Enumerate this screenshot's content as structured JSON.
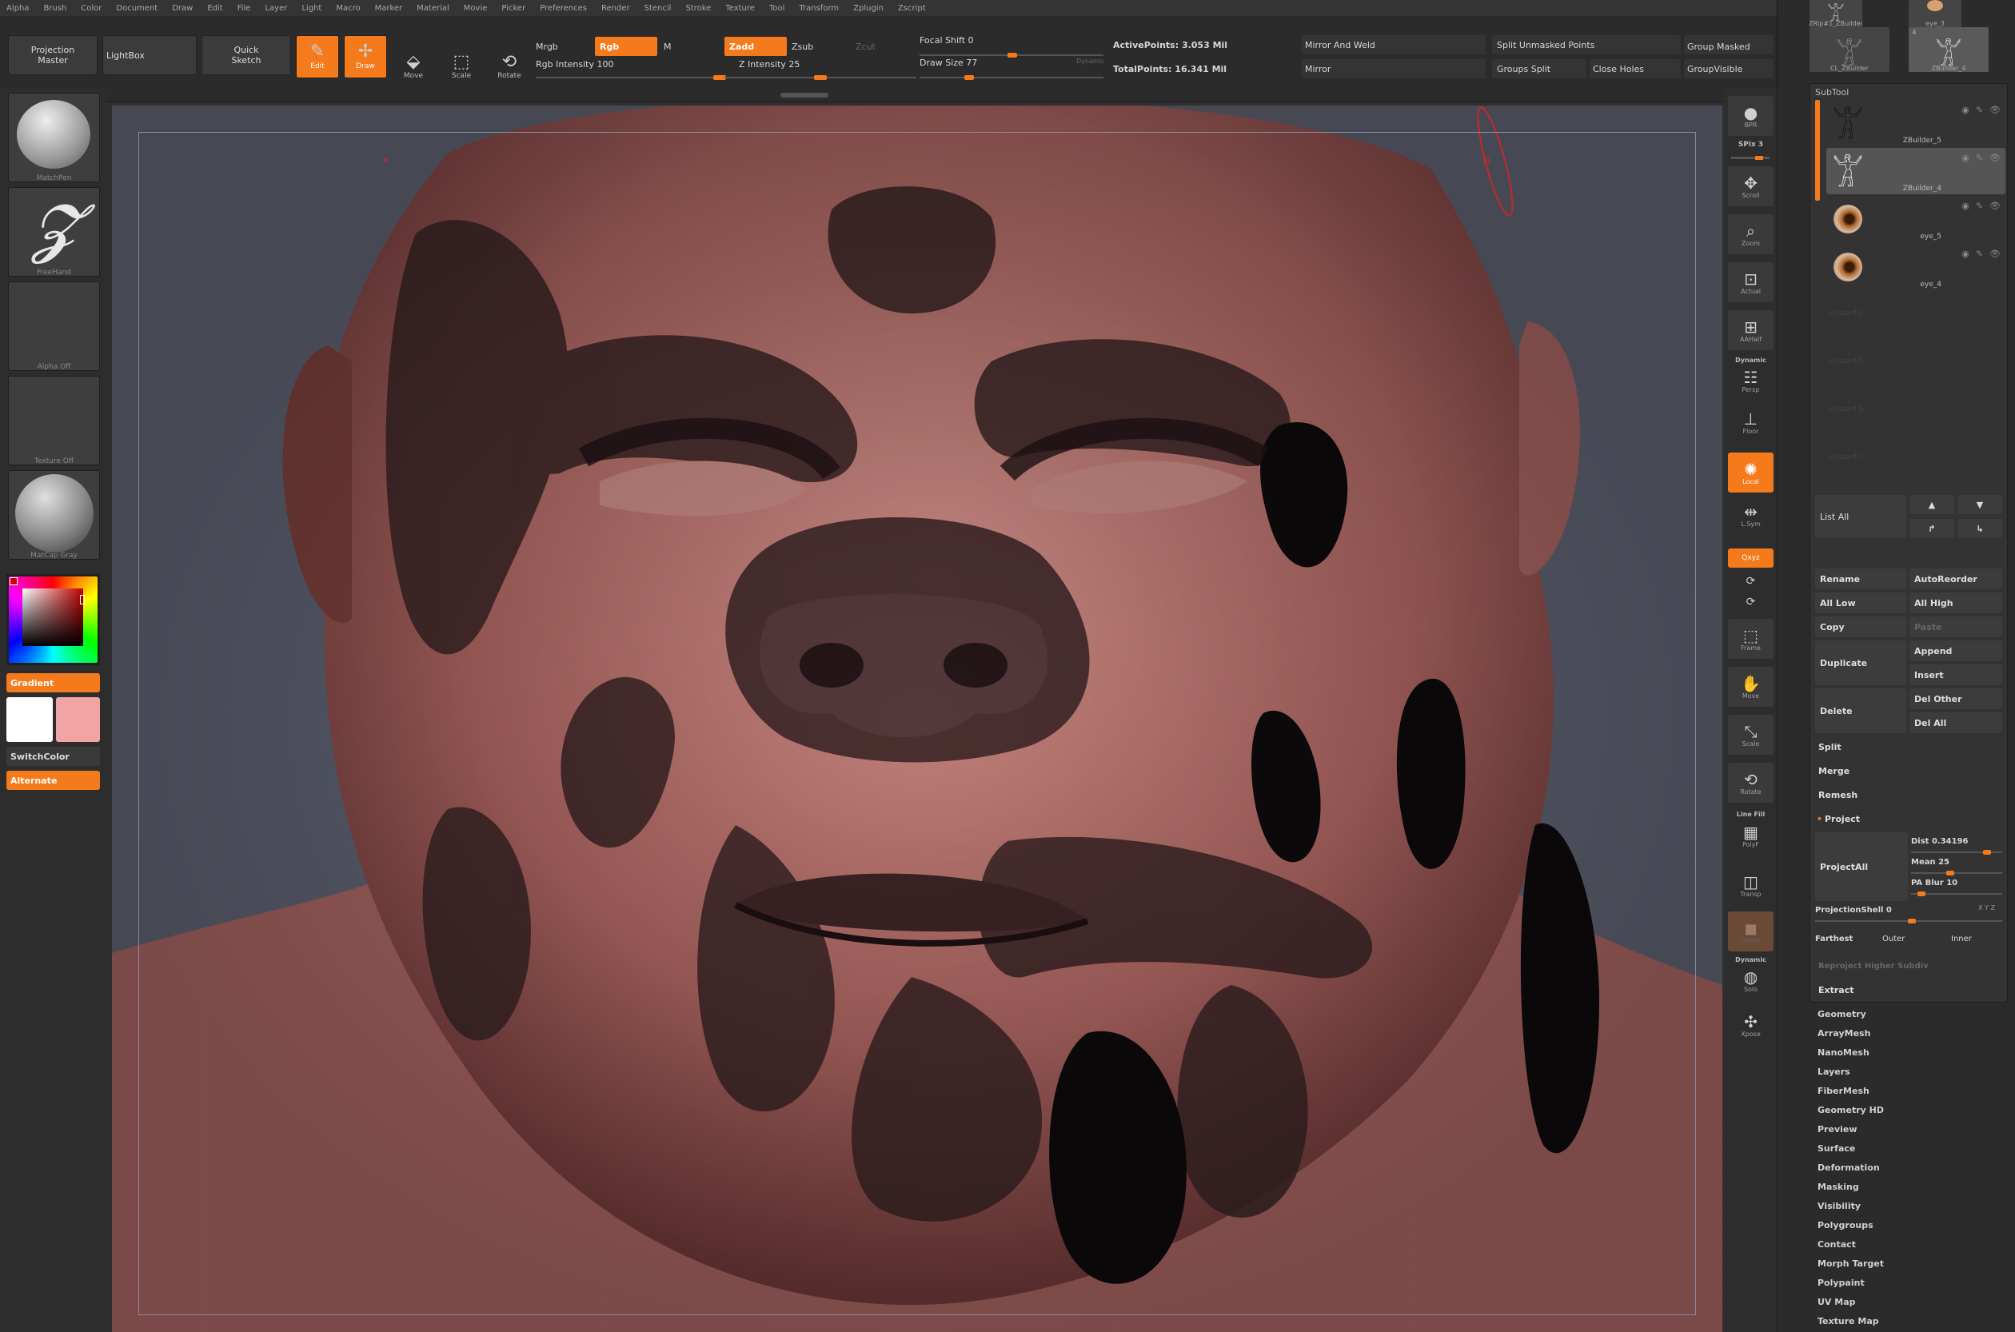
{
  "menu": [
    "Alpha",
    "Brush",
    "Color",
    "Document",
    "Draw",
    "Edit",
    "File",
    "Layer",
    "Light",
    "Macro",
    "Marker",
    "Material",
    "Movie",
    "Picker",
    "Preferences",
    "Render",
    "Stencil",
    "Stroke",
    "Texture",
    "Tool",
    "Transform",
    "Zplugin",
    "Zscript"
  ],
  "topshelf": {
    "projection_master": "Projection\nMaster",
    "lightbox": "LightBox",
    "quick_sketch": "Quick\nSketch",
    "edit": "Edit",
    "draw": "Draw",
    "move": "Move",
    "scale": "Scale",
    "rotate": "Rotate",
    "mrgb": "Mrgb",
    "rgb": "Rgb",
    "m": "M",
    "zadd": "Zadd",
    "zsub": "Zsub",
    "zcut": "Zcut",
    "rgb_intensity": "Rgb Intensity 100",
    "z_intensity": "Z Intensity 25",
    "focal_shift": "Focal Shift 0",
    "draw_size": "Draw Size 77",
    "dynamic": "Dynamic",
    "active_points": "ActivePoints: 3.053 Mil",
    "total_points": "TotalPoints: 16.341 Mil",
    "mirror_and_weld": "Mirror And Weld",
    "mirror": "Mirror",
    "split_unmasked": "Split Unmasked Points",
    "groups_split": "Groups Split",
    "close_holes": "Close Holes",
    "group_masked": "Group Masked",
    "group_visible": "GroupVisible"
  },
  "leftshelf": {
    "brush_cap": "MatchPen",
    "stroke_cap": "FreeHand",
    "alpha_cap": "Alpha Off",
    "texture_cap": "Texture Off",
    "material_cap": "MatCap Gray",
    "gradient": "Gradient",
    "switch_color": "SwitchColor",
    "alternate": "Alternate",
    "main_color": "#ffffff",
    "secondary_color": "#f2a3a3",
    "accent": "#f47a1b"
  },
  "rightshelf": {
    "bpr": "BPR",
    "spix": "SPix 3",
    "scroll": "Scroll",
    "zoom": "Zoom",
    "actual": "Actual",
    "aahalf": "AAHalf",
    "dynamic": "Dynamic",
    "persp": "Persp",
    "floor": "Floor",
    "local": "Local",
    "lsym": "L.Sym",
    "xyz": "Qxyz",
    "frame": "Frame",
    "move": "Move",
    "scale": "Scale",
    "rotate": "Rotate",
    "line_fill": "Line Fill",
    "polyf": "PolyF",
    "transp": "Transp",
    "ghost": "Ghost",
    "dynamic2": "Dynamic",
    "solo": "Solo",
    "xpose": "Xpose"
  },
  "tools": {
    "t1": "ZRip#1_ZBuilder",
    "t2": "eye_3",
    "t3": "CL_ZBuilder",
    "t4": "ZBuilder_4",
    "t4_count": "4"
  },
  "subtool": {
    "title": "SubTool",
    "items": [
      {
        "name": "ZBuilder_5"
      },
      {
        "name": "ZBuilder_4"
      },
      {
        "name": "eye_5"
      },
      {
        "name": "eye_4"
      }
    ],
    "empty_slots": [
      "Unused 4",
      "Unused 5",
      "Unused 6",
      "Unused 7"
    ],
    "list_all": "List All",
    "rename": "Rename",
    "auto_reorder": "AutoReorder",
    "all_low": "All Low",
    "all_high": "All High",
    "copy": "Copy",
    "paste": "Paste",
    "append": "Append",
    "duplicate": "Duplicate",
    "insert": "Insert",
    "del_other": "Del Other",
    "delete": "Delete",
    "del_all": "Del All",
    "split": "Split",
    "merge": "Merge",
    "remesh": "Remesh",
    "project": "Project",
    "project_all": "ProjectAll",
    "dist": "Dist 0.34196",
    "mean": "Mean 25",
    "pa_blur": "PA Blur 10",
    "projection_shell": "ProjectionShell 0",
    "xyz_small": "X Y Z",
    "farthest": "Farthest",
    "outer": "Outer",
    "inner": "Inner",
    "reproject": "Reproject Higher Subdiv",
    "extract": "Extract"
  },
  "tool_menus": [
    "Geometry",
    "ArrayMesh",
    "NanoMesh",
    "Layers",
    "FiberMesh",
    "Geometry HD",
    "Preview",
    "Surface",
    "Deformation",
    "Masking",
    "Visibility",
    "Polygroups",
    "Contact",
    "Morph Target",
    "Polypaint",
    "UV Map",
    "Texture Map"
  ]
}
